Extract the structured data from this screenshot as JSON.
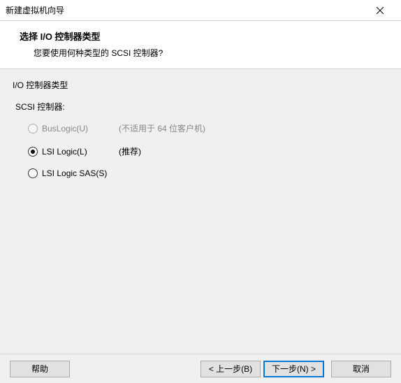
{
  "window": {
    "title": "新建虚拟机向导"
  },
  "header": {
    "title": "选择 I/O 控制器类型",
    "subtitle": "您要使用何种类型的 SCSI 控制器?"
  },
  "content": {
    "group_title": "I/O 控制器类型",
    "subgroup_title": "SCSI 控制器:",
    "options": [
      {
        "label": "BusLogic(U)",
        "hint": "(不适用于 64 位客户机)",
        "checked": false,
        "disabled": true
      },
      {
        "label": "LSI Logic(L)",
        "hint": "(推荐)",
        "checked": true,
        "disabled": false
      },
      {
        "label": "LSI Logic SAS(S)",
        "hint": "",
        "checked": false,
        "disabled": false
      }
    ]
  },
  "footer": {
    "help": "帮助",
    "back": "< 上一步(B)",
    "next": "下一步(N) >",
    "cancel": "取消"
  }
}
